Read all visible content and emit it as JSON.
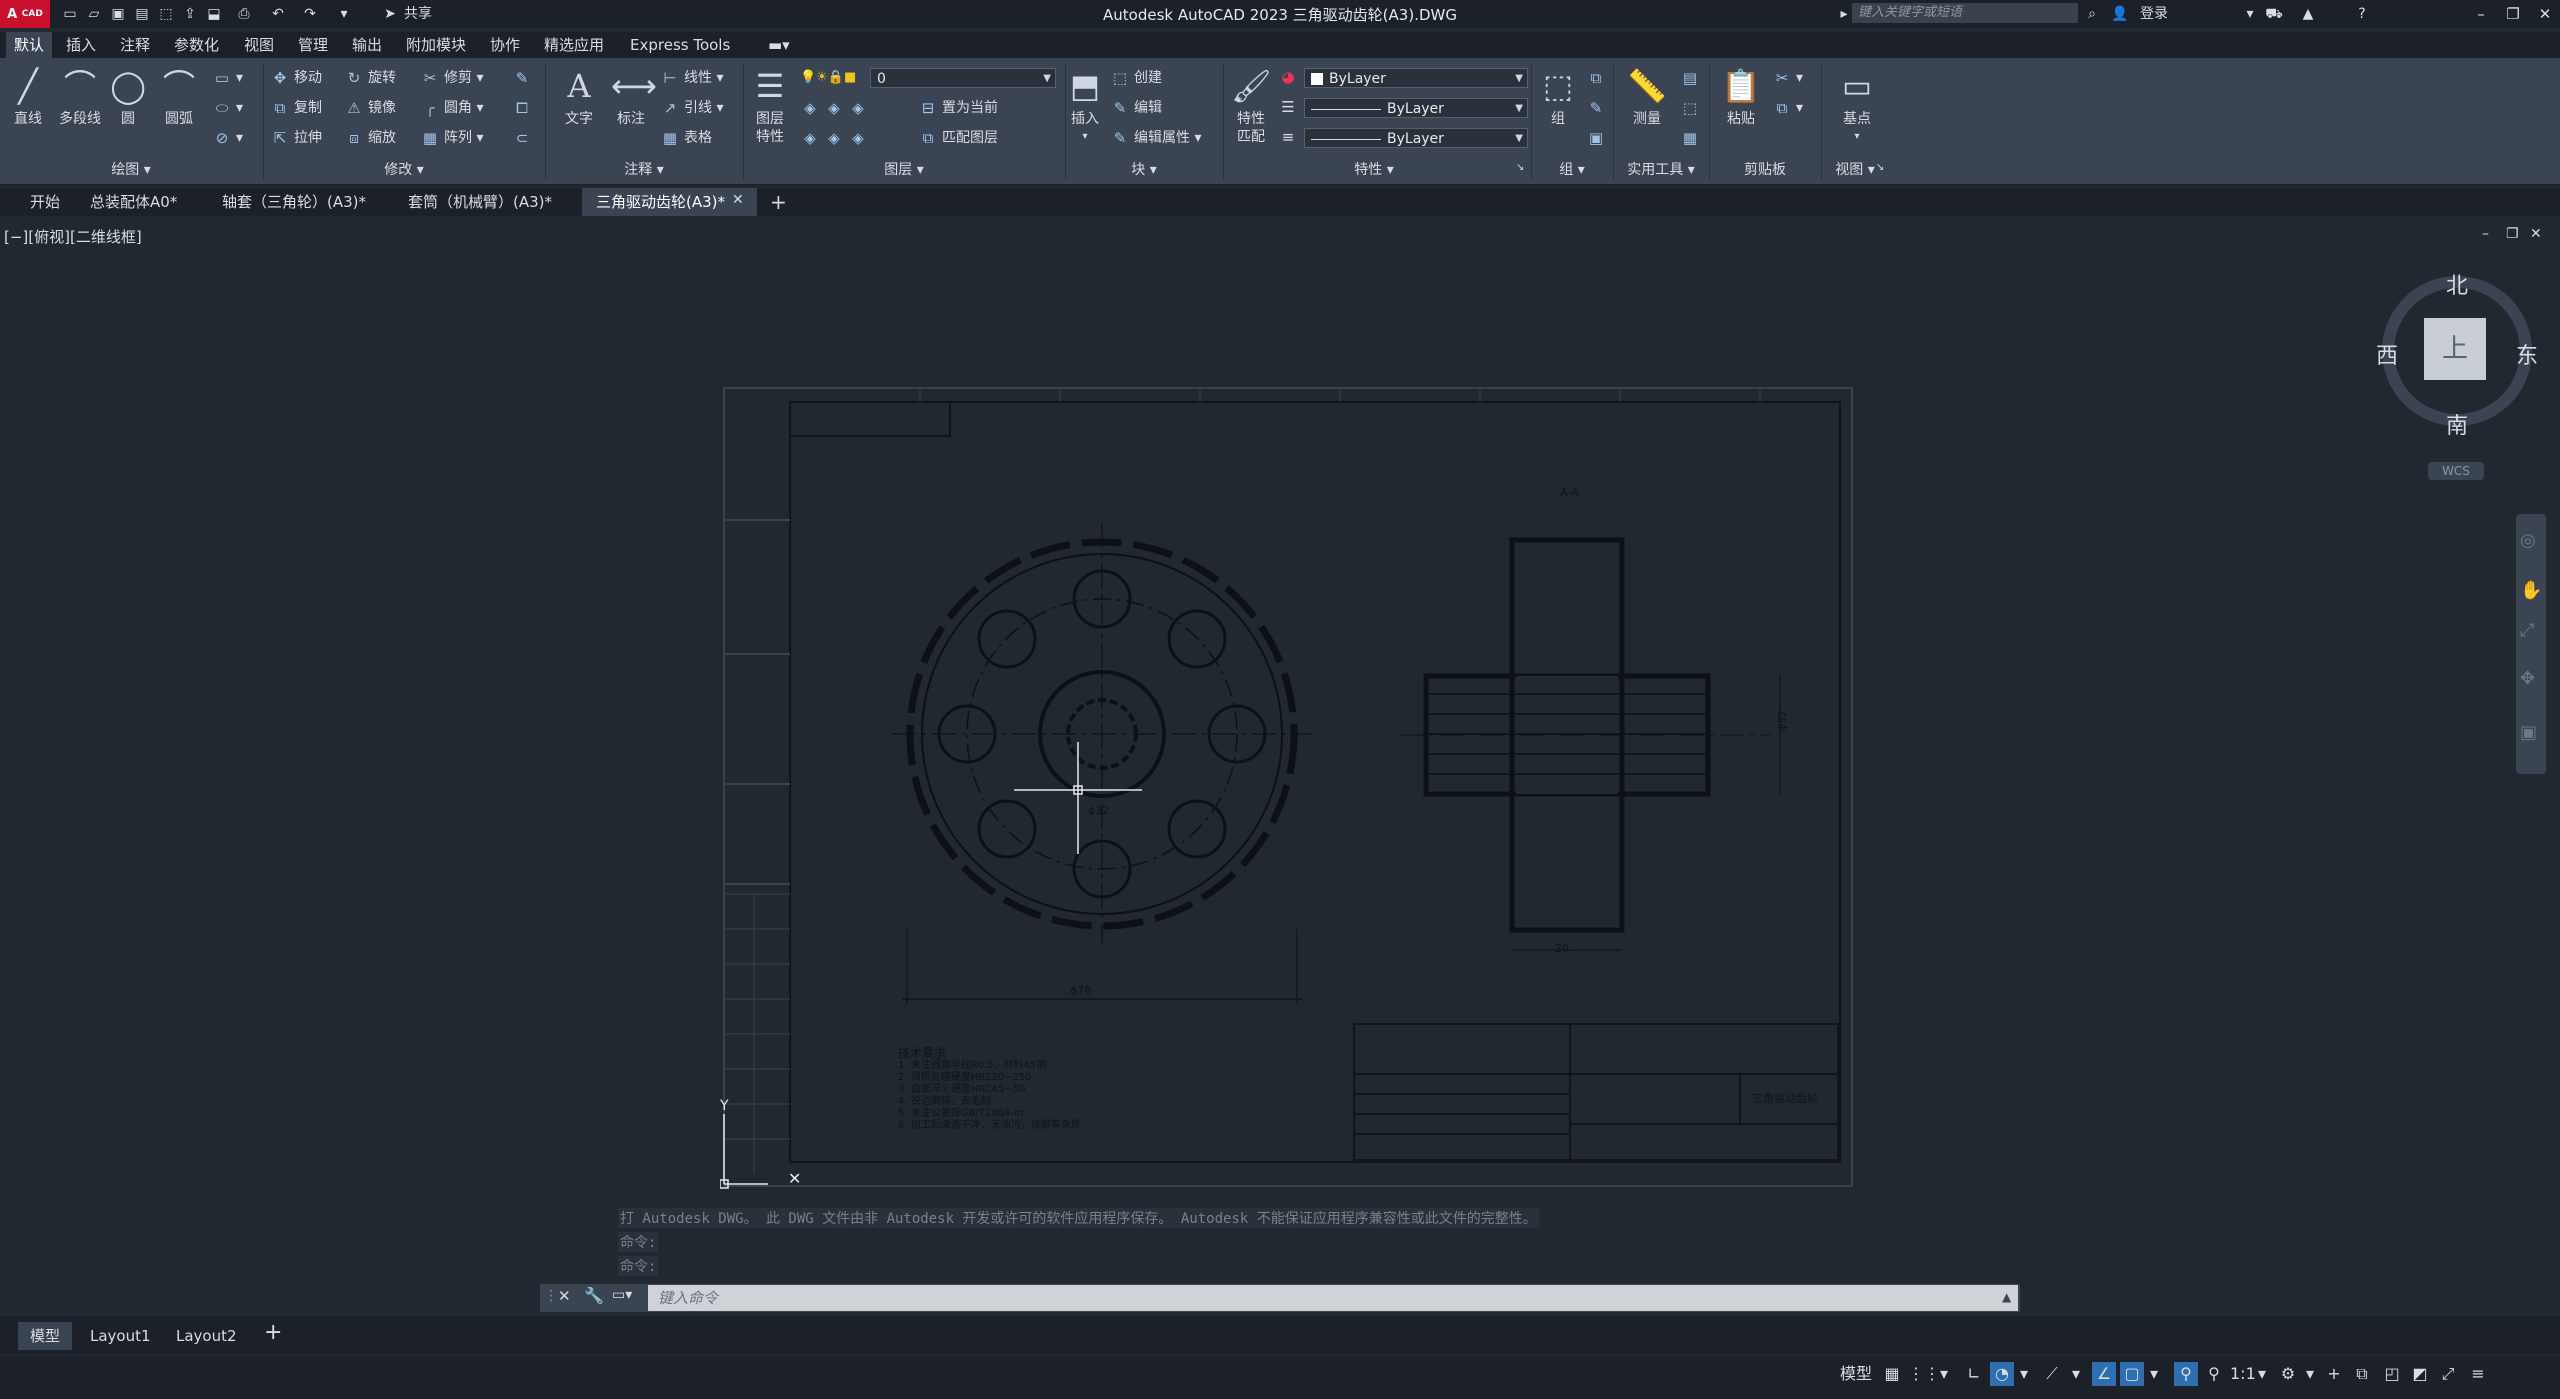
{
  "titlebar": {
    "app_badge": "CAD",
    "share_label": "共享",
    "title": "Autodesk AutoCAD 2023    三角驱动齿轮(A3).DWG",
    "search_placeholder": "键入关键字或短语",
    "login_label": "登录"
  },
  "ribbon_tabs": [
    "默认",
    "插入",
    "注释",
    "参数化",
    "视图",
    "管理",
    "输出",
    "附加模块",
    "协作",
    "精选应用",
    "Express Tools"
  ],
  "ribbon": {
    "draw": {
      "line": "直线",
      "polyline": "多段线",
      "circle": "圆",
      "arc": "圆弧",
      "panel": "绘图"
    },
    "modify": {
      "move": "移动",
      "rotate": "旋转",
      "trim": "修剪",
      "copy": "复制",
      "mirror": "镜像",
      "fillet": "圆角",
      "stretch": "拉伸",
      "scale": "缩放",
      "array": "阵列",
      "panel": "修改"
    },
    "annotation": {
      "text": "文字",
      "dimension": "标注",
      "linear": "线性",
      "leader": "引线",
      "table": "表格",
      "panel": "注释"
    },
    "layers": {
      "layer_props_1": "图层",
      "layer_props_2": "特性",
      "current_layer": "0",
      "set_current": "置为当前",
      "match_layer": "匹配图层",
      "panel": "图层"
    },
    "block": {
      "insert": "插入",
      "create": "创建",
      "edit": "编辑",
      "edit_attributes": "编辑属性",
      "panel": "块"
    },
    "properties": {
      "match_1": "特性",
      "match_2": "匹配",
      "color": "ByLayer",
      "linetype": "ByLayer",
      "lineweight": "ByLayer",
      "panel": "特性"
    },
    "groups": {
      "group": "组",
      "panel": "组"
    },
    "utilities": {
      "measure": "测量",
      "panel": "实用工具"
    },
    "clipboard": {
      "paste": "粘贴",
      "panel": "剪贴板"
    },
    "view": {
      "base": "基点",
      "panel": "视图"
    }
  },
  "file_tabs": [
    {
      "label": "开始",
      "active": false
    },
    {
      "label": "总装配体A0*",
      "active": false
    },
    {
      "label": "轴套（三角轮）(A3)*",
      "active": false
    },
    {
      "label": "套筒（机械臂）(A3)*",
      "active": false
    },
    {
      "label": "三角驱动齿轮(A3)*",
      "active": true
    }
  ],
  "viewport_label": "[−][俯视][二维线框]",
  "viewcube": {
    "north": "北",
    "south": "南",
    "east": "东",
    "west": "西",
    "top": "上",
    "wcs": "WCS"
  },
  "drawing": {
    "section_label": "A-A",
    "dim_diameter": "ϕ32",
    "dim_outer": "ϕ78",
    "dim_width": "20",
    "dim_side": "ϕ32",
    "tech_title": "技术要求",
    "tech_notes": [
      "1. 未注圆角半径R0.5，材料45钢",
      "2. 调质处理硬度HB220~250",
      "3. 齿面淬火硬度HRC45~50",
      "4. 锐边倒钝，去毛刺",
      "5. 未注公差按GB/T1804-m",
      "6. 加工后清洗干净，无油污，铁屑等杂质"
    ],
    "title_block_name": "三角驱动齿轮"
  },
  "command": {
    "history_1": "打 Autodesk DWG。  此 DWG 文件由非 Autodesk 开发或许可的软件应用程序保存。  Autodesk 不能保证应用程序兼容性或此文件的完整性。",
    "history_2": "命令:",
    "history_3": "命令:",
    "input_placeholder": "键入命令"
  },
  "layout_tabs": [
    {
      "label": "模型",
      "active": true
    },
    {
      "label": "Layout1",
      "active": false
    },
    {
      "label": "Layout2",
      "active": false
    }
  ],
  "statusbar": {
    "model": "模型",
    "scale": "1:1"
  }
}
